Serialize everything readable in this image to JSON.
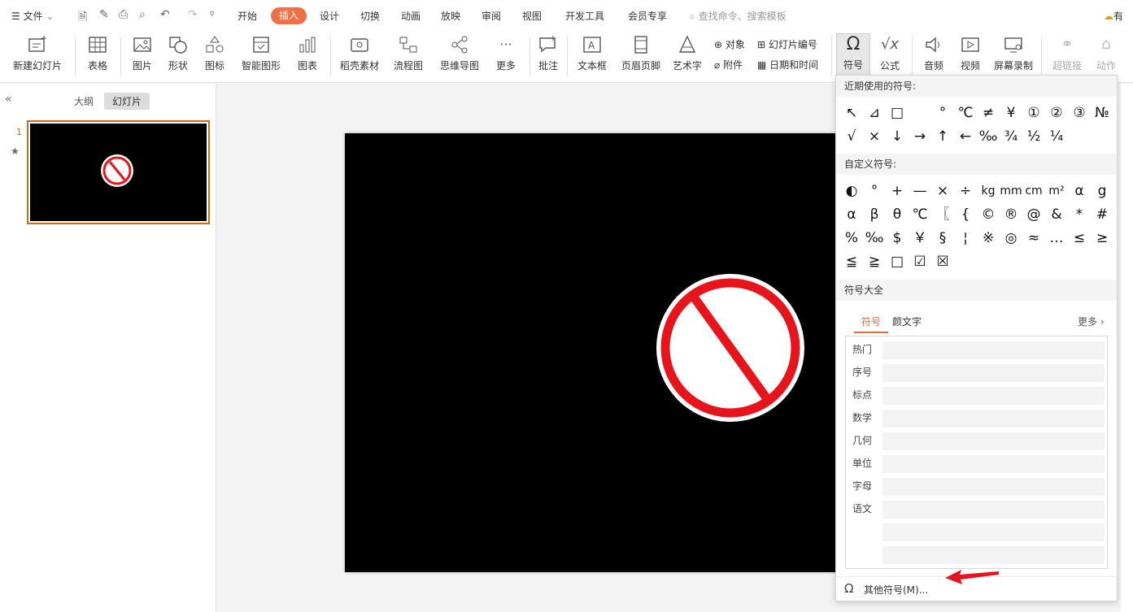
{
  "menubar": {
    "file_label": "文件",
    "tabs": [
      "开始",
      "插入",
      "设计",
      "切换",
      "动画",
      "放映",
      "审阅",
      "视图",
      "开发工具",
      "会员专享"
    ],
    "active_tab": "插入",
    "search_placeholder": "查找命令、搜索模板",
    "right_label": "有"
  },
  "ribbon": {
    "items": [
      "新建幻灯片",
      "表格",
      "图片",
      "形状",
      "图标",
      "智能图形",
      "图表",
      "稻壳素材",
      "流程图",
      "思维导图",
      "更多",
      "批注",
      "文本框",
      "页眉页脚",
      "艺术字"
    ],
    "small": {
      "object": "对象",
      "attach": "附件",
      "slide_no": "幻灯片编号",
      "datetime": "日期和时间"
    },
    "right_items": [
      "符号",
      "公式",
      "音频",
      "视频",
      "屏幕录制",
      "超链接",
      "动作"
    ]
  },
  "left_panel": {
    "tab_outline": "大纲",
    "tab_slides": "幻灯片",
    "slide_number": "1"
  },
  "symbol_panel": {
    "recent_title": "近期使用的符号:",
    "recent": [
      "↖",
      "⊿",
      "□",
      "",
      "°",
      "℃",
      "≠",
      "¥",
      "①",
      "②",
      "③",
      "№",
      "√",
      "×",
      "↓",
      "→",
      "↑",
      "←",
      "‰",
      "¾",
      "½",
      "¼"
    ],
    "custom_title": "自定义符号:",
    "custom": [
      "◐",
      "°",
      "+",
      "—",
      "×",
      "÷",
      "kg",
      "mm",
      "cm",
      "m²",
      "α",
      "g",
      "α",
      "β",
      "θ",
      "℃",
      "〖",
      "{",
      "©",
      "®",
      "@",
      "&",
      "*",
      "#",
      "%",
      "‰",
      "$",
      "￥",
      "§",
      "¦",
      "※",
      "◎",
      "≈",
      "…",
      "≤",
      "≥",
      "≦",
      "≧",
      "□",
      "☑",
      "☒"
    ],
    "all_title": "符号大全",
    "tab_symbol": "符号",
    "tab_emoticon": "颜文字",
    "more": "更多",
    "categories": [
      "热门",
      "序号",
      "标点",
      "数学",
      "几何",
      "单位",
      "字母",
      "语文"
    ],
    "footer": "其他符号(M)..."
  },
  "colors": {
    "accent": "#f06f46",
    "prohibit_red": "#e8141c"
  }
}
